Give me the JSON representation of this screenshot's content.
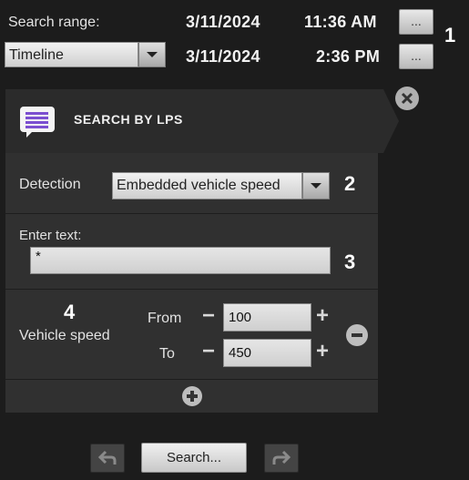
{
  "search_range": {
    "label": "Search range:",
    "mode": "Timeline",
    "start_date": "3/11/2024",
    "start_time": "11:36 AM",
    "end_date": "3/11/2024",
    "end_time": "2:36 PM",
    "picker_label": "..."
  },
  "callouts": {
    "c1": "1",
    "c2": "2",
    "c3": "3",
    "c4": "4"
  },
  "panel": {
    "title": "SEARCH BY LPS",
    "detection_label": "Detection",
    "detection_value": "Embedded vehicle speed",
    "enter_text_label": "Enter text:",
    "text_value": "*",
    "speed_label": "Vehicle speed",
    "from_label": "From",
    "from_value": "100",
    "to_label": "To",
    "to_value": "450"
  },
  "bottom": {
    "search_label": "Search..."
  }
}
